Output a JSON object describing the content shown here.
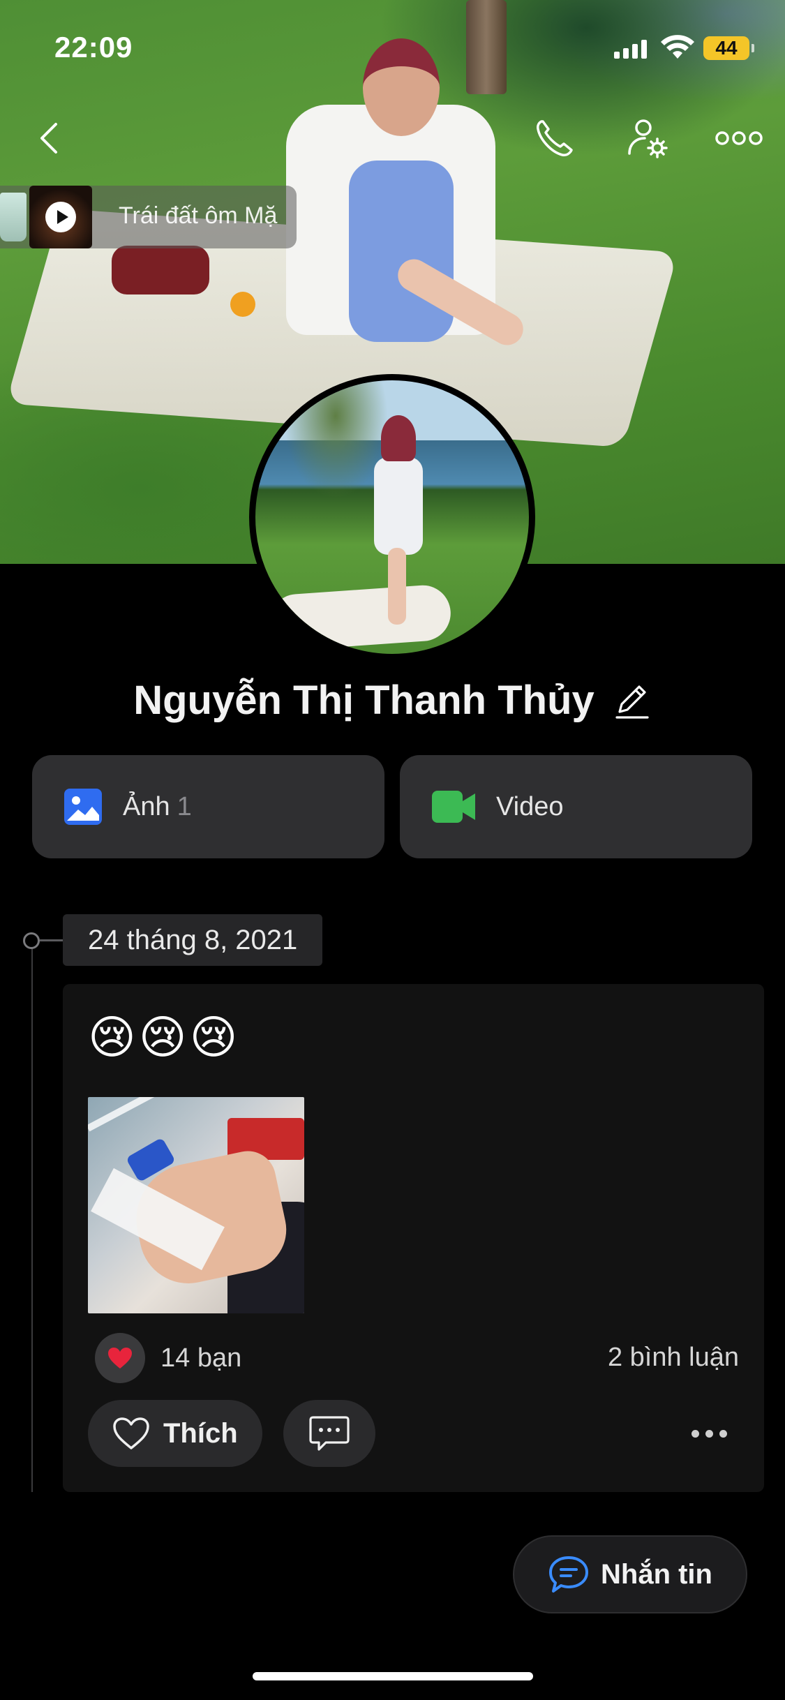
{
  "status_bar": {
    "time": "22:09",
    "battery": "44",
    "battery_color": "#f4c528"
  },
  "header": {
    "back_icon": "chevron-left-icon",
    "call_icon": "phone-icon",
    "settings_icon": "user-settings-icon",
    "more_icon": "more-horizontal-icon"
  },
  "music": {
    "title": "Trái đất ôm Mặ"
  },
  "profile": {
    "name": "Nguyễn Thị Thanh Thủy"
  },
  "tiles": {
    "photo_label": "Ảnh",
    "photo_count": "1",
    "video_label": "Video",
    "photo_icon_color": "#2f6cf0",
    "video_icon_color": "#3cba54"
  },
  "timeline": {
    "date": "24 tháng 8, 2021"
  },
  "post": {
    "text": "😢😢😢",
    "reactions_label": "14 bạn",
    "comments_label": "2 bình luận",
    "like_label": "Thích"
  },
  "fab": {
    "message_label": "Nhắn tin",
    "icon_color": "#3a8cff"
  }
}
